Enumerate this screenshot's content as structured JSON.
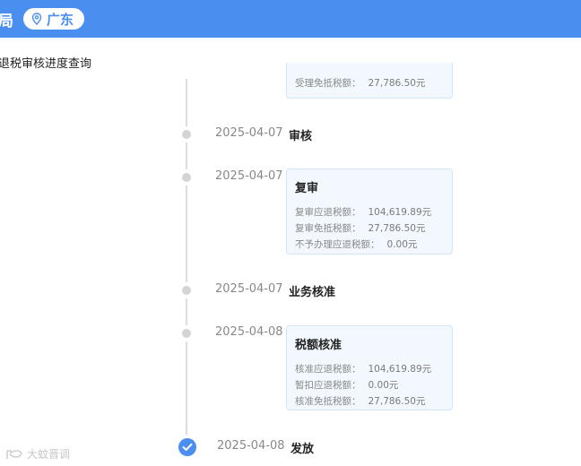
{
  "header": {
    "title": "局",
    "region": "广东"
  },
  "subtitle": "退税审核进度查询",
  "top_card": {
    "label": "受理免抵税额：",
    "value": "27,786.50元"
  },
  "steps": [
    {
      "date": "2025-04-07",
      "title": "审核"
    },
    {
      "date": "2025-04-07",
      "title": "复审",
      "rows": [
        {
          "label": "复审应退税额：",
          "value": "104,619.89元"
        },
        {
          "label": "复审免抵税额：",
          "value": "27,786.50元"
        },
        {
          "label": "不予办理应退税额：",
          "value": "0.00元"
        }
      ]
    },
    {
      "date": "2025-04-07",
      "title": "业务核准"
    },
    {
      "date": "2025-04-08",
      "title": "税额核准",
      "rows": [
        {
          "label": "核准应退税额：",
          "value": "104,619.89元"
        },
        {
          "label": "暂扣应退税额：",
          "value": "0.00元"
        },
        {
          "label": "核准免抵税额：",
          "value": "27,786.50元"
        }
      ]
    },
    {
      "date": "2025-04-08",
      "title": "发放"
    }
  ],
  "watermark": "大蚊晋调",
  "colors": {
    "brand": "#4a8ef0",
    "card_bg": "#f2f8fe"
  }
}
